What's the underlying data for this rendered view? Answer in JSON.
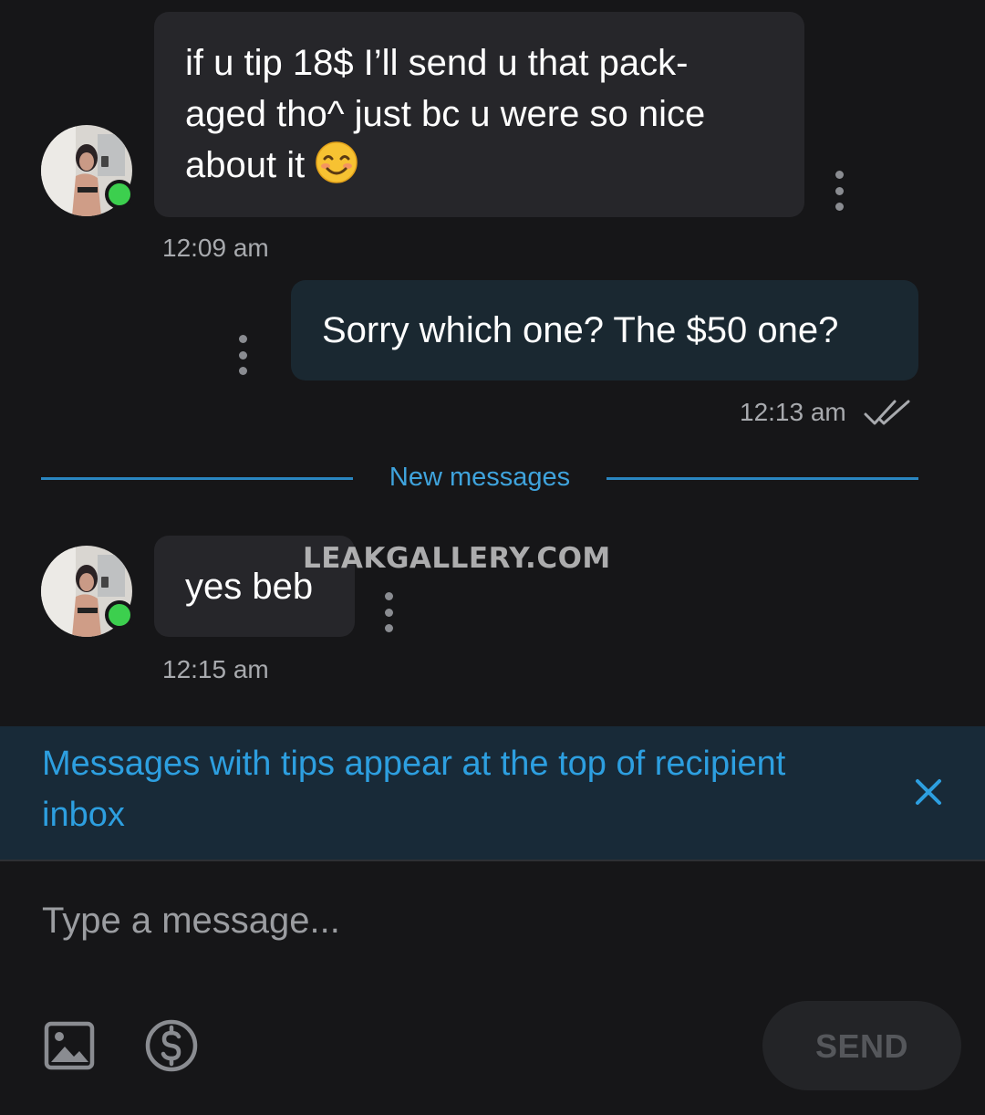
{
  "thread": {
    "messages": [
      {
        "direction": "incoming",
        "text": "if u tip 18$ I’ll send u that pack-aged tho^ just bc u were so nice about it",
        "lines": [
          "if u tip 18$ I’ll send u that pack-",
          "aged tho^ just bc u were so nice",
          "about it"
        ],
        "emoji": "smiling-face-emoji",
        "time": "12:09 am",
        "sender_online": true
      },
      {
        "direction": "outgoing",
        "text": "Sorry which one? The $50 one?",
        "time": "12:13 am",
        "status": "read"
      },
      {
        "direction": "incoming",
        "text": "yes beb",
        "time": "12:15 am",
        "sender_online": true
      }
    ],
    "divider_label": "New messages",
    "watermark": "LEAKGALLERY.COM"
  },
  "tip_banner": {
    "text": "Messages with tips appear at the top of recipient inbox",
    "close_icon": "close-icon"
  },
  "composer": {
    "placeholder": "Type a message...",
    "value": "",
    "send_label": "SEND",
    "send_enabled": false,
    "tools": [
      "image-icon",
      "dollar-icon"
    ]
  },
  "colors": {
    "background": "#161618",
    "incoming_bubble": "#26262a",
    "outgoing_bubble": "#1a2831",
    "accent": "#2d9fe0",
    "divider": "#2a86c0",
    "online": "#3ccf4e",
    "banner": "#182a38"
  }
}
